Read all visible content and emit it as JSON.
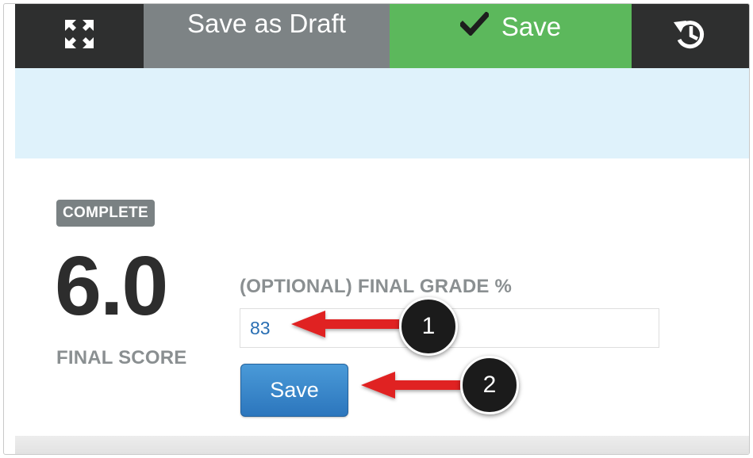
{
  "toolbar": {
    "expand_icon": "expand-arrows-icon",
    "draft_label": "Save as Draft",
    "save_label": "Save",
    "check_icon": "check-icon",
    "history_icon": "history-icon"
  },
  "grading": {
    "status_badge": "COMPLETE",
    "final_score": "6.0",
    "final_score_label": "FINAL SCORE",
    "grade_label": "(OPTIONAL) FINAL GRADE %",
    "grade_value": "83",
    "save_label": "Save"
  },
  "annotations": {
    "marker_1": "1",
    "marker_2": "2"
  },
  "colors": {
    "toolbar_dark": "#2e2f2f",
    "draft_gray": "#7d8385",
    "save_green": "#5cb85c",
    "info_band": "#dff2fb",
    "badge_gray": "#7a8183",
    "save_blue": "#2c76bd",
    "arrow_red": "#e02020"
  }
}
